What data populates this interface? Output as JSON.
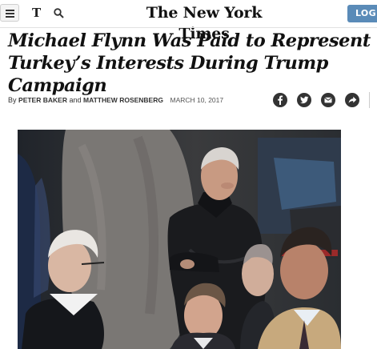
{
  "header": {
    "menu_icon": "hamburger-menu-icon",
    "section_logo": "T",
    "search_icon": "search-icon",
    "brand": "The New York Times",
    "login_label": "LOG IN"
  },
  "article": {
    "headline": "Michael Flynn Was Paid to Represent Turkey’s Interests During Trump Campaign",
    "byline_prefix": "By",
    "author1": "PETER BAKER",
    "conjunction": "and",
    "author2": "MATTHEW ROSENBERG",
    "date": "MARCH 10, 2017"
  },
  "share": [
    "facebook-icon",
    "twitter-icon",
    "email-icon",
    "share-icon"
  ],
  "colors": {
    "login_bg": "#5a8bb8",
    "share_bg": "#333333"
  }
}
